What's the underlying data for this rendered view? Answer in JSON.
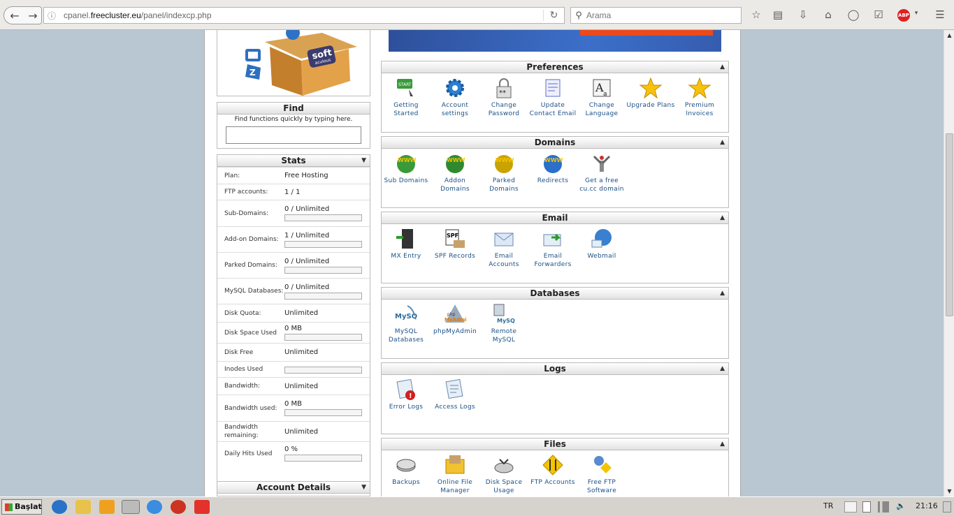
{
  "browser": {
    "url_prefix": "cpanel.",
    "url_domain": "freecluster.eu",
    "url_path": "/panel/indexcp.php",
    "search_placeholder": "Arama",
    "abp_label": "ABP"
  },
  "sidebar": {
    "find": {
      "title": "Find",
      "hint": "Find functions quickly by typing here."
    },
    "stats": {
      "title": "Stats",
      "rows": [
        {
          "label": "Plan:",
          "value": "Free Hosting",
          "bar": false
        },
        {
          "label": "FTP accounts:",
          "value": "1 / 1",
          "bar": false
        },
        {
          "label": "Sub-Domains:",
          "value": "0 / Unlimited",
          "bar": true
        },
        {
          "label": "Add-on Domains:",
          "value": "1 / Unlimited",
          "bar": true
        },
        {
          "label": "Parked Domains:",
          "value": "0 / Unlimited",
          "bar": true
        },
        {
          "label": "MySQL Databases:",
          "value": "0 / Unlimited",
          "bar": true
        },
        {
          "label": "Disk Quota:",
          "value": "Unlimited",
          "bar": false
        },
        {
          "label": "Disk Space Used",
          "value": "0 MB",
          "bar": true
        },
        {
          "label": "Disk Free",
          "value": "Unlimited",
          "bar": false
        },
        {
          "label": "Inodes Used",
          "value": "",
          "bar": true
        },
        {
          "label": "Bandwidth:",
          "value": "Unlimited",
          "bar": false
        },
        {
          "label": "Bandwidth used:",
          "value": "0 MB",
          "bar": true
        },
        {
          "label": "Bandwidth remaining:",
          "value": "Unlimited",
          "bar": false
        },
        {
          "label": "Daily Hits Used",
          "value": "0 %",
          "bar": true
        }
      ]
    },
    "account_details": {
      "title": "Account Details"
    }
  },
  "logo": {
    "brand": "soft",
    "sub": "aculous"
  },
  "panels": [
    {
      "title": "Preferences",
      "items": [
        {
          "label": "Getting Started",
          "icon": "getting-started-icon"
        },
        {
          "label": "Account settings",
          "icon": "gear-icon"
        },
        {
          "label": "Change Password",
          "icon": "lock-icon"
        },
        {
          "label": "Update Contact Email",
          "icon": "contact-email-icon"
        },
        {
          "label": "Change Language",
          "icon": "language-icon"
        },
        {
          "label": "Upgrade Plans",
          "icon": "star-icon"
        },
        {
          "label": "Premium Invoices",
          "icon": "star-icon"
        }
      ]
    },
    {
      "title": "Domains",
      "items": [
        {
          "label": "Sub Domains",
          "icon": "www-sub-icon"
        },
        {
          "label": "Addon Domains",
          "icon": "www-addon-icon"
        },
        {
          "label": "Parked Domains",
          "icon": "www-parked-icon"
        },
        {
          "label": "Redirects",
          "icon": "www-redirect-icon"
        },
        {
          "label": "Get a free cu.cc domain",
          "icon": "satellite-icon"
        }
      ]
    },
    {
      "title": "Email",
      "items": [
        {
          "label": "MX Entry",
          "icon": "server-icon"
        },
        {
          "label": "SPF Records",
          "icon": "spf-icon"
        },
        {
          "label": "Email Accounts",
          "icon": "envelope-icon"
        },
        {
          "label": "Email Forwarders",
          "icon": "email-forward-icon"
        },
        {
          "label": "Webmail",
          "icon": "webmail-globe-icon"
        }
      ]
    },
    {
      "title": "Databases",
      "items": [
        {
          "label": "MySQL Databases",
          "icon": "mysql-icon"
        },
        {
          "label": "phpMyAdmin",
          "icon": "phpmyadmin-icon"
        },
        {
          "label": "Remote MySQL",
          "icon": "remote-mysql-icon"
        }
      ]
    },
    {
      "title": "Logs",
      "items": [
        {
          "label": "Error Logs",
          "icon": "error-log-icon"
        },
        {
          "label": "Access Logs",
          "icon": "access-log-icon"
        }
      ]
    },
    {
      "title": "Files",
      "items": [
        {
          "label": "Backups",
          "icon": "backup-disk-icon"
        },
        {
          "label": "Online File Manager",
          "icon": "folder-icon"
        },
        {
          "label": "Disk Space Usage",
          "icon": "disk-usage-icon"
        },
        {
          "label": "FTP Accounts",
          "icon": "ftp-icon"
        },
        {
          "label": "Free FTP Software",
          "icon": "ftp-software-icon"
        }
      ]
    }
  ],
  "taskbar": {
    "start_label": "Başlat",
    "lang": "TR",
    "clock": "21:16"
  }
}
